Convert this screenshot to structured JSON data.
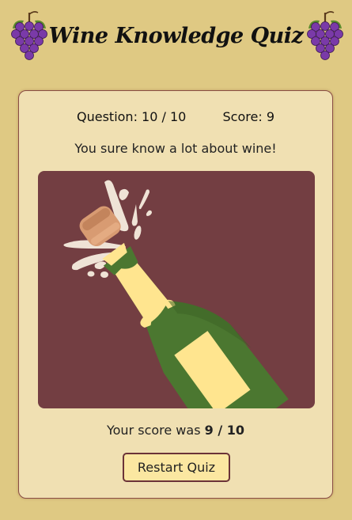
{
  "header": {
    "title": "Wine Knowledge Quiz",
    "left_icon": "grapes-icon",
    "right_icon": "grapes-icon"
  },
  "quiz": {
    "question_label": "Question:",
    "question_value": "10 / 10",
    "score_label": "Score:",
    "score_value": "9",
    "message": "You sure know a lot about wine!",
    "image_icon": "champagne-bottle-popping-icon",
    "final_prefix": "Your score was",
    "final_value": "9 / 10",
    "restart_label": "Restart Quiz"
  },
  "colors": {
    "page_background": "#dfc983",
    "card_background": "#f0e0b2",
    "image_background": "#733e42",
    "button_background": "#fbe7a1",
    "button_border": "#6b3338",
    "bottle_green": "#4b7730",
    "bottle_label": "#ffe58f",
    "cork": "#d89b72"
  }
}
